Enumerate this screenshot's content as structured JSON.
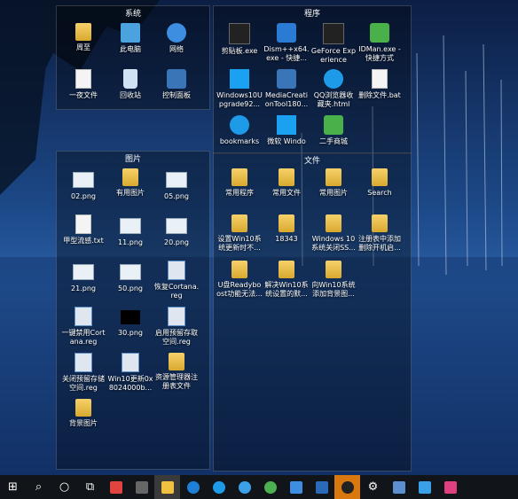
{
  "fences": {
    "system": {
      "title": "系统",
      "icons": [
        {
          "label": "周至",
          "icon": "folder-icon"
        },
        {
          "label": "此电脑",
          "icon": "computer-icon"
        },
        {
          "label": "网络",
          "icon": "network-icon"
        },
        {
          "label": "一夜文件",
          "icon": "document-icon"
        },
        {
          "label": "回收站",
          "icon": "recycle-bin-icon"
        },
        {
          "label": "控制面板",
          "icon": "control-panel-icon"
        }
      ]
    },
    "programs": {
      "title": "程序",
      "icons": [
        {
          "label": "剪贴板.exe",
          "icon": "clipboard-icon"
        },
        {
          "label": "Dism++x64.exe - 快捷...",
          "icon": "gear-icon"
        },
        {
          "label": "GeForce Experience",
          "icon": "geforce-icon"
        },
        {
          "label": "IDMan.exe - 快捷方式",
          "icon": "idm-icon"
        },
        {
          "label": "Windows10Upgrade92...",
          "icon": "windows-icon"
        },
        {
          "label": "MediaCreationTool180...",
          "icon": "media-tool-icon"
        },
        {
          "label": "QQ浏览器收藏夹.html",
          "icon": "qq-browser-icon"
        },
        {
          "label": "删除文件.bat",
          "icon": "bat-file-icon"
        },
        {
          "label": "bookmarks",
          "icon": "edge-icon"
        },
        {
          "label": "微软 Windo",
          "icon": "windows-icon"
        },
        {
          "label": "二手商城",
          "icon": "shop-icon"
        }
      ]
    },
    "pictures": {
      "title": "图片",
      "icons": [
        {
          "label": "02.png",
          "icon": "image-icon"
        },
        {
          "label": "有用图片",
          "icon": "folder-icon"
        },
        {
          "label": "05.png",
          "icon": "image-icon"
        },
        {
          "label": "甲型流感.txt",
          "icon": "text-file-icon"
        },
        {
          "label": "11.png",
          "icon": "image-icon"
        },
        {
          "label": "20.png",
          "icon": "image-icon"
        },
        {
          "label": "21.png",
          "icon": "image-icon"
        },
        {
          "label": "50.png",
          "icon": "image-icon"
        },
        {
          "label": "恢复Cortana.reg",
          "icon": "registry-icon"
        },
        {
          "label": "一键禁用Cortana.reg",
          "icon": "registry-icon"
        },
        {
          "label": "30.png",
          "icon": "image-black-icon"
        },
        {
          "label": "启用预留存取空间.reg",
          "icon": "registry-icon"
        },
        {
          "label": "关闭预留存储空间.reg",
          "icon": "registry-icon"
        },
        {
          "label": "Win10更新0x8024000b...",
          "icon": "registry-icon"
        },
        {
          "label": "资源管理器注册表文件",
          "icon": "folder-icon"
        },
        {
          "label": "背景图片",
          "icon": "folder-icon"
        }
      ]
    },
    "files": {
      "title": "文件",
      "icons": [
        {
          "label": "常用程序",
          "icon": "folder-icon"
        },
        {
          "label": "常用文件",
          "icon": "folder-icon"
        },
        {
          "label": "常用图片",
          "icon": "folder-icon"
        },
        {
          "label": "Search",
          "icon": "folder-icon"
        },
        {
          "label": "设置Win10系统更新时不...",
          "icon": "folder-icon"
        },
        {
          "label": "18343",
          "icon": "folder-icon"
        },
        {
          "label": "Windows 10系统关闭SS...",
          "icon": "folder-icon"
        },
        {
          "label": "注册表中添加删除开机启...",
          "icon": "folder-icon"
        },
        {
          "label": "U盘Readyboost功能无法...",
          "icon": "folder-icon"
        },
        {
          "label": "解决Win10系统设置的默...",
          "icon": "folder-icon"
        },
        {
          "label": "向Win10系统添加背景图...",
          "icon": "folder-icon"
        }
      ]
    }
  },
  "taskbar": {
    "items": [
      {
        "name": "start-button",
        "glyph": "⊞"
      },
      {
        "name": "search-button",
        "glyph": "⌕"
      },
      {
        "name": "cortana-button",
        "glyph": "○"
      },
      {
        "name": "task-view-button",
        "glyph": "⧉"
      },
      {
        "name": "app-power-button",
        "color": "#e0443e"
      },
      {
        "name": "app-calculator-button",
        "color": "#555"
      },
      {
        "name": "app-explorer-button",
        "color": "#f2c041"
      },
      {
        "name": "app-edge-button",
        "color": "#1e7fd8"
      },
      {
        "name": "app-qq-browser-button",
        "color": "#1e9be8"
      },
      {
        "name": "app-ie-button",
        "color": "#3aa0e8"
      },
      {
        "name": "app-chrome-button",
        "color": "#4caf50"
      },
      {
        "name": "app-bird-button",
        "color": "#3d8ee0"
      },
      {
        "name": "app-store-button",
        "color": "#2a6ab8"
      },
      {
        "name": "app-qq-button",
        "color": "#222"
      },
      {
        "name": "app-settings-button",
        "glyph": "⚙"
      },
      {
        "name": "app-iobit-button",
        "color": "#5b8fd0"
      },
      {
        "name": "app-outlook-button",
        "color": "#3aa0e8"
      },
      {
        "name": "app-pink-button",
        "color": "#e0407f"
      }
    ]
  },
  "colors": {
    "taskbar_bg": "#111418",
    "qq_selected": "#d9780f",
    "wallpaper_dark": "#0a1a3a",
    "wallpaper_light": "#3b6fb5"
  }
}
